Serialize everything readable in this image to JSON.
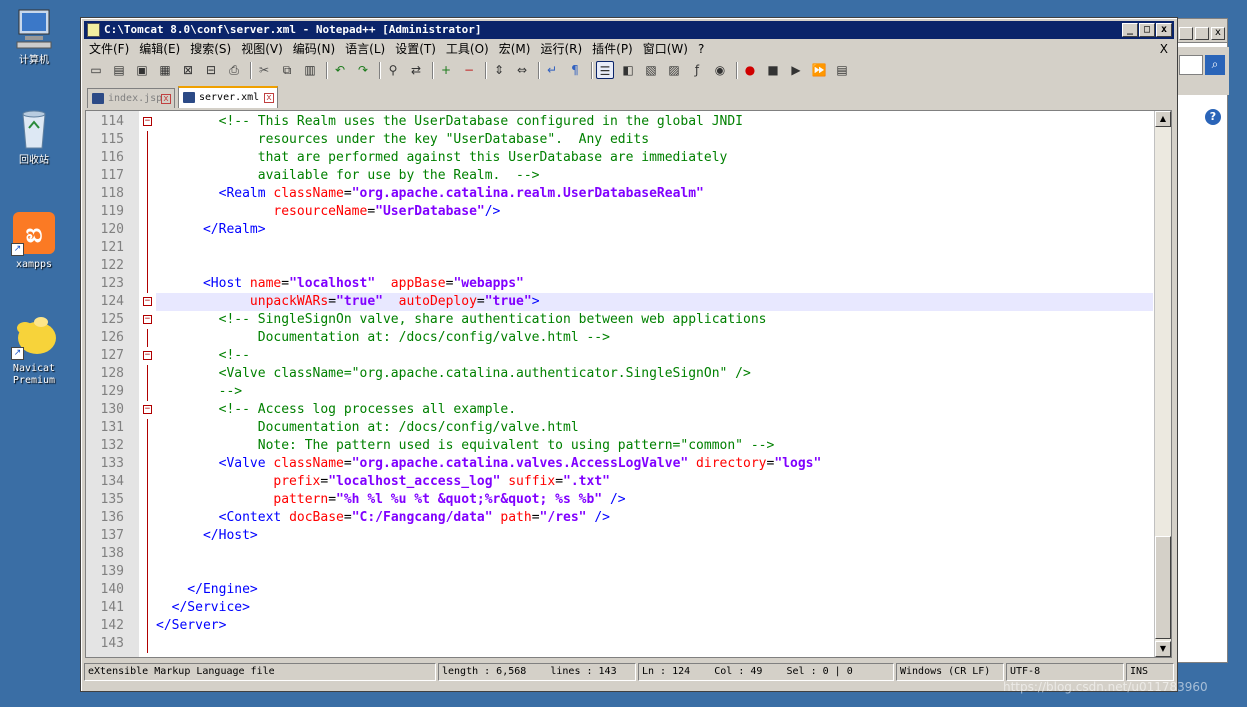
{
  "desktop": {
    "icons": [
      {
        "label": "计算机",
        "icon": "computer-icon"
      },
      {
        "label": "回收站",
        "icon": "recycle-bin-icon"
      },
      {
        "label": "xampps",
        "icon": "xampp-icon"
      },
      {
        "label": "Navicat\nPremium",
        "icon": "navicat-icon"
      }
    ]
  },
  "window": {
    "title": "C:\\Tomcat 8.0\\conf\\server.xml - Notepad++ [Administrator]",
    "controls": {
      "minimize": "_",
      "maximize": "□",
      "close": "x"
    }
  },
  "menubar": {
    "items": [
      "文件(F)",
      "编辑(E)",
      "搜索(S)",
      "视图(V)",
      "编码(N)",
      "语言(L)",
      "设置(T)",
      "工具(O)",
      "宏(M)",
      "运行(R)",
      "插件(P)",
      "窗口(W)",
      "?"
    ],
    "close": "X"
  },
  "toolbar": {
    "icons": [
      "new-file-icon",
      "open-file-icon",
      "save-icon",
      "save-all-icon",
      "close-icon",
      "close-all-icon",
      "print-icon",
      "cut-icon",
      "copy-icon",
      "paste-icon",
      "undo-icon",
      "redo-icon",
      "find-icon",
      "replace-icon",
      "zoom-in-icon",
      "zoom-out-icon",
      "sync-v-icon",
      "sync-h-icon",
      "wrap-icon",
      "show-all-chars-icon",
      "indent-guide-icon",
      "lang-icon",
      "folder-icon",
      "doc-map-icon",
      "function-list-icon",
      "monitor-icon",
      "record-macro-icon",
      "stop-macro-icon",
      "play-macro-icon",
      "run-macro-multiple-icon",
      "save-macro-icon"
    ]
  },
  "tabs": [
    {
      "label": "index.jsp",
      "active": false
    },
    {
      "label": "server.xml",
      "active": true
    }
  ],
  "editor": {
    "current_line": "124",
    "lines": [
      {
        "n": "114",
        "fold": "open",
        "segs": [
          [
            "com",
            "        <!-- This Realm uses the UserDatabase configured in the global JNDI"
          ]
        ]
      },
      {
        "n": "115",
        "segs": [
          [
            "com",
            "             resources under the key \"UserDatabase\".  Any edits"
          ]
        ]
      },
      {
        "n": "116",
        "segs": [
          [
            "com",
            "             that are performed against this UserDatabase are immediately"
          ]
        ]
      },
      {
        "n": "117",
        "segs": [
          [
            "com",
            "             available for use by the Realm.  -->"
          ]
        ]
      },
      {
        "n": "118",
        "segs": [
          [
            "tag",
            "        <Realm "
          ],
          [
            "attr",
            "className"
          ],
          [
            "eq",
            "="
          ],
          [
            "val",
            "\"org.apache.catalina.realm.UserDatabaseRealm\""
          ]
        ]
      },
      {
        "n": "119",
        "segs": [
          [
            "attr",
            "               resourceName"
          ],
          [
            "eq",
            "="
          ],
          [
            "val",
            "\"UserDatabase\""
          ],
          [
            "tag",
            "/>"
          ]
        ]
      },
      {
        "n": "120",
        "segs": [
          [
            "tag",
            "      </Realm>"
          ]
        ]
      },
      {
        "n": "121",
        "segs": []
      },
      {
        "n": "122",
        "segs": []
      },
      {
        "n": "123",
        "segs": [
          [
            "tag",
            "      <Host "
          ],
          [
            "attr",
            "name"
          ],
          [
            "eq",
            "="
          ],
          [
            "val",
            "\"localhost\""
          ],
          [
            "attr",
            "  appBase"
          ],
          [
            "eq",
            "="
          ],
          [
            "val",
            "\"webapps\""
          ]
        ]
      },
      {
        "n": "124",
        "fold": "open",
        "segs": [
          [
            "attr",
            "            unpackWARs"
          ],
          [
            "eq",
            "="
          ],
          [
            "val",
            "\"true\""
          ],
          [
            "attr",
            "  autoDeploy"
          ],
          [
            "eq",
            "="
          ],
          [
            "val",
            "\"true\""
          ],
          [
            "tag",
            ">"
          ]
        ]
      },
      {
        "n": "125",
        "fold": "open",
        "segs": [
          [
            "com",
            "        <!-- SingleSignOn valve, share authentication between web applications"
          ]
        ]
      },
      {
        "n": "126",
        "segs": [
          [
            "com",
            "             Documentation at: /docs/config/valve.html -->"
          ]
        ]
      },
      {
        "n": "127",
        "fold": "open",
        "segs": [
          [
            "com",
            "        <!--"
          ]
        ]
      },
      {
        "n": "128",
        "segs": [
          [
            "com",
            "        <Valve className=\"org.apache.catalina.authenticator.SingleSignOn\" />"
          ]
        ]
      },
      {
        "n": "129",
        "segs": [
          [
            "com",
            "        -->"
          ]
        ]
      },
      {
        "n": "130",
        "fold": "open",
        "segs": [
          [
            "com",
            "        <!-- Access log processes all example."
          ]
        ]
      },
      {
        "n": "131",
        "segs": [
          [
            "com",
            "             Documentation at: /docs/config/valve.html"
          ]
        ]
      },
      {
        "n": "132",
        "segs": [
          [
            "com",
            "             Note: The pattern used is equivalent to using pattern=\"common\" -->"
          ]
        ]
      },
      {
        "n": "133",
        "segs": [
          [
            "tag",
            "        <Valve "
          ],
          [
            "attr",
            "className"
          ],
          [
            "eq",
            "="
          ],
          [
            "val",
            "\"org.apache.catalina.valves.AccessLogValve\""
          ],
          [
            "attr",
            " directory"
          ],
          [
            "eq",
            "="
          ],
          [
            "val",
            "\"logs\""
          ]
        ]
      },
      {
        "n": "134",
        "segs": [
          [
            "attr",
            "               prefix"
          ],
          [
            "eq",
            "="
          ],
          [
            "val",
            "\"localhost_access_log\""
          ],
          [
            "attr",
            " suffix"
          ],
          [
            "eq",
            "="
          ],
          [
            "val",
            "\".txt\""
          ]
        ]
      },
      {
        "n": "135",
        "segs": [
          [
            "attr",
            "               pattern"
          ],
          [
            "eq",
            "="
          ],
          [
            "val",
            "\"%h %l %u %t &quot;%r&quot; %s %b\""
          ],
          [
            "tag",
            " />"
          ]
        ]
      },
      {
        "n": "136",
        "segs": [
          [
            "tag",
            "        <Context "
          ],
          [
            "attr",
            "docBase"
          ],
          [
            "eq",
            "="
          ],
          [
            "val",
            "\"C:/Fangcang/data\""
          ],
          [
            "attr",
            " path"
          ],
          [
            "eq",
            "="
          ],
          [
            "val",
            "\"/res\""
          ],
          [
            "tag",
            " />"
          ]
        ]
      },
      {
        "n": "137",
        "segs": [
          [
            "tag",
            "      </Host>"
          ]
        ]
      },
      {
        "n": "138",
        "segs": []
      },
      {
        "n": "139",
        "segs": []
      },
      {
        "n": "140",
        "segs": [
          [
            "tag",
            "    </Engine>"
          ]
        ]
      },
      {
        "n": "141",
        "segs": [
          [
            "tag",
            "  </Service>"
          ]
        ]
      },
      {
        "n": "142",
        "segs": [
          [
            "tag",
            "</Server>"
          ]
        ]
      },
      {
        "n": "143",
        "segs": []
      }
    ]
  },
  "statusbar": {
    "filetype": "eXtensible Markup Language file",
    "length": "length : 6,568    lines : 143",
    "position": "Ln : 124    Col : 49    Sel : 0 | 0",
    "eol": "Windows (CR LF)",
    "encoding": "UTF-8",
    "mode": "INS"
  },
  "watermark": "https://blog.csdn.net/u011783960"
}
